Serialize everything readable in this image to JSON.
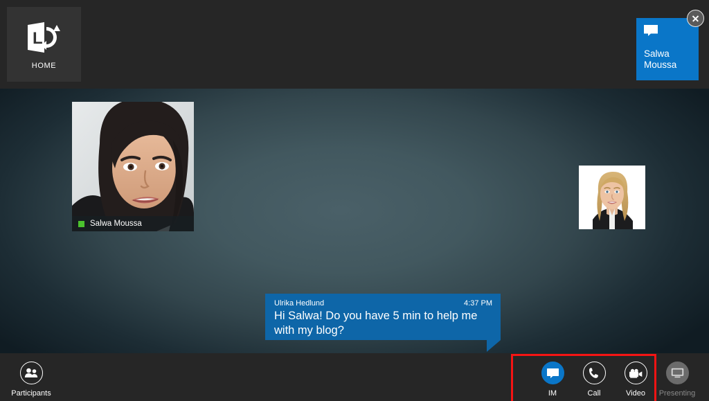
{
  "window": {
    "app_name": "Microsoft Lync",
    "background_accent": "#3f545c"
  },
  "topbar": {
    "background": "#262626",
    "home_tile": {
      "label": "HOME",
      "icon": "lync-logo-icon"
    },
    "contact_tile": {
      "name": "Salwa Moussa",
      "icon": "chat-bubble-icon",
      "color": "#0a76c8"
    },
    "close_button": {
      "icon": "close-icon",
      "label": "Close"
    }
  },
  "stage": {
    "main_video": {
      "participant_name": "Salwa Moussa",
      "presence": "Available",
      "presence_color": "#4bc22e"
    },
    "thumbnail_video": {
      "participant_name": "Ulrika Hedlund"
    }
  },
  "im_toast": {
    "sender": "Ulrika Hedlund",
    "time": "4:37 PM",
    "message": "Hi Salwa! Do you have 5 min to help me with my blog?",
    "color": "#0e66a8"
  },
  "bottombar": {
    "background": "#262626",
    "buttons": [
      {
        "label": "Participants",
        "icon": "participants-icon",
        "state": "enabled"
      },
      {
        "label": "IM",
        "icon": "im-chat-icon",
        "state": "active"
      },
      {
        "label": "Call",
        "icon": "phone-icon",
        "state": "enabled"
      },
      {
        "label": "Video",
        "icon": "video-camera-icon",
        "state": "enabled"
      },
      {
        "label": "Presenting",
        "icon": "monitor-icon",
        "state": "disabled"
      }
    ]
  },
  "annotation": {
    "highlight_color": "#f51414",
    "note": "red rectangle around IM, Call and Video buttons"
  }
}
